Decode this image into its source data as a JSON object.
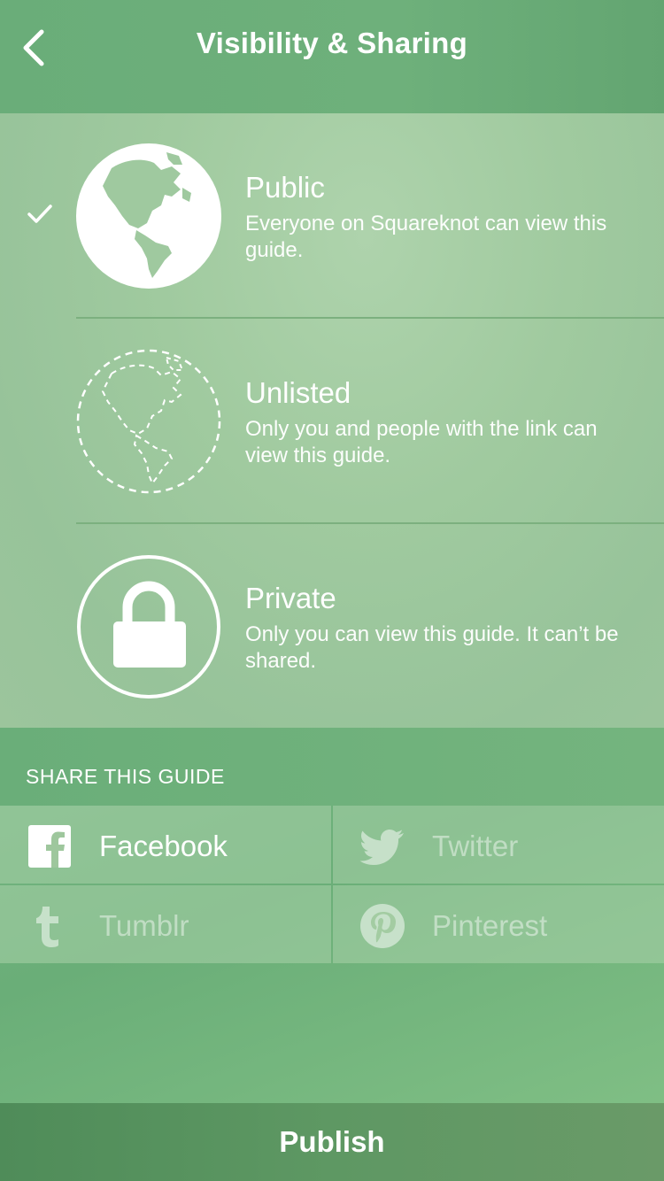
{
  "nav": {
    "title": "Visibility & Sharing",
    "back_icon": "chevron-left-icon"
  },
  "visibility": {
    "selected": "Public",
    "options": [
      {
        "title": "Public",
        "description": "Everyone on Squareknot can view this guide.",
        "icon": "globe-filled-icon",
        "selected": true
      },
      {
        "title": "Unlisted",
        "description": "Only you and people with the link can view this guide.",
        "icon": "globe-dashed-icon",
        "selected": false
      },
      {
        "title": "Private",
        "description": "Only you can view this guide. It can’t be shared.",
        "icon": "lock-icon",
        "selected": false
      }
    ]
  },
  "share": {
    "header": "SHARE THIS GUIDE",
    "items": [
      {
        "label": "Facebook",
        "icon": "facebook-icon",
        "enabled": true
      },
      {
        "label": "Twitter",
        "icon": "twitter-icon",
        "enabled": false
      },
      {
        "label": "Tumblr",
        "icon": "tumblr-icon",
        "enabled": false
      },
      {
        "label": "Pinterest",
        "icon": "pinterest-icon",
        "enabled": false
      }
    ]
  },
  "publish": {
    "label": "Publish"
  },
  "colors": {
    "accent": "#6aad79",
    "panel": "#a4cca3",
    "publish_bar": "#5a9460"
  }
}
